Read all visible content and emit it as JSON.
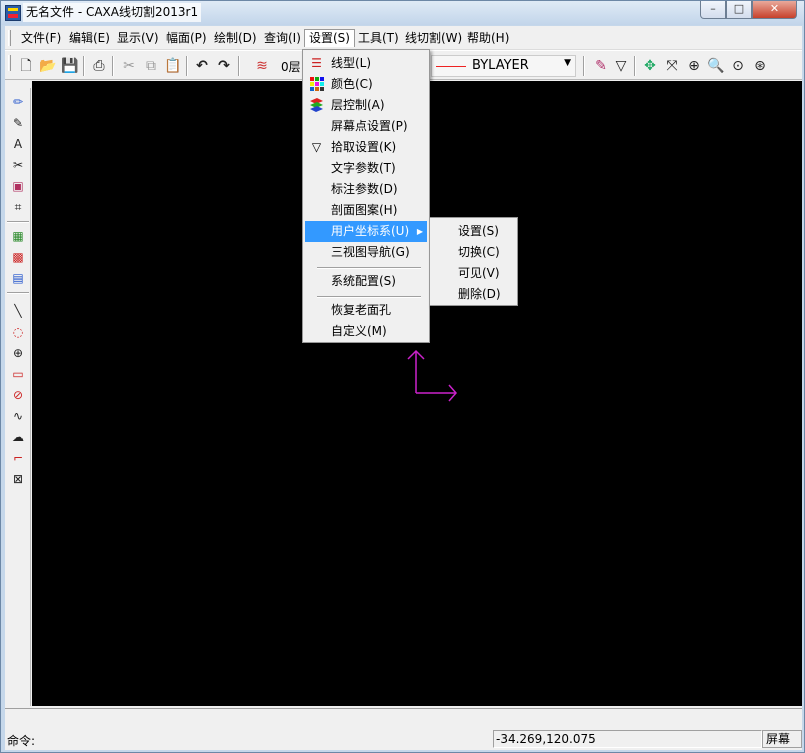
{
  "window": {
    "title": "无名文件 - CAXA线切割2013r1",
    "controls": {
      "minimize": "–",
      "maximize": "□",
      "close": "✕"
    }
  },
  "menubar": {
    "items": [
      {
        "label": "文件(F)"
      },
      {
        "label": "编辑(E)"
      },
      {
        "label": "显示(V)"
      },
      {
        "label": "幅面(P)"
      },
      {
        "label": "绘制(D)"
      },
      {
        "label": "查询(I)"
      },
      {
        "label": "设置(S)"
      },
      {
        "label": "工具(T)"
      },
      {
        "label": "线切割(W)"
      },
      {
        "label": "帮助(H)"
      }
    ],
    "active_index": 6
  },
  "toolbar": {
    "layer_label": "0层",
    "linetype_value": "BYLAYER",
    "icons": [
      "new-file-icon",
      "open-file-icon",
      "save-icon",
      "print-icon",
      "cut-icon",
      "copy-icon",
      "paste-icon",
      "undo-icon",
      "redo-icon",
      "layer-icon",
      "linetype-icon",
      "pick-filter-icon",
      "pan-icon",
      "dynamic-pan-icon",
      "zoom-in-icon",
      "zoom-window-icon",
      "zoom-previous-icon",
      "zoom-all-icon"
    ]
  },
  "settings_menu": {
    "items": [
      {
        "label": "线型(L)",
        "icon": "linetype-icon"
      },
      {
        "label": "颜色(C)",
        "icon": "color-palette-icon"
      },
      {
        "label": "层控制(A)",
        "icon": "layers-icon"
      },
      {
        "label": "屏幕点设置(P)",
        "icon": ""
      },
      {
        "label": "拾取设置(K)",
        "icon": "pick-filter-icon"
      },
      {
        "label": "文字参数(T)",
        "icon": ""
      },
      {
        "label": "标注参数(D)",
        "icon": ""
      },
      {
        "label": "剖面图案(H)",
        "icon": ""
      },
      {
        "label": "用户坐标系(U)",
        "icon": "",
        "highlighted": true,
        "submenu": true
      },
      {
        "label": "三视图导航(G)",
        "icon": ""
      },
      {
        "label": "系统配置(S)",
        "icon": ""
      },
      {
        "label": "恢复老面孔",
        "icon": ""
      },
      {
        "label": "自定义(M)",
        "icon": ""
      }
    ]
  },
  "ucs_submenu": {
    "items": [
      {
        "label": "设置(S)"
      },
      {
        "label": "切换(C)"
      },
      {
        "label": "可见(V)"
      },
      {
        "label": "删除(D)"
      }
    ]
  },
  "canvas": {
    "background": "#000000",
    "ucs_color": "#cc22cc"
  },
  "statusbar": {
    "command_label": "命令:",
    "coordinates": "-34.269,120.075",
    "mode": "屏幕"
  }
}
